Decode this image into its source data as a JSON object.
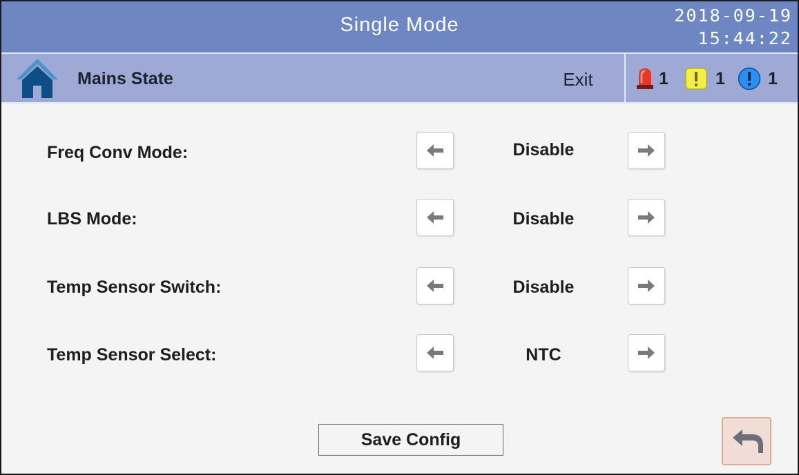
{
  "header": {
    "title": "Single Mode",
    "date": "2018-09-19",
    "time": "15:44:22"
  },
  "subbar": {
    "home_icon": "home-icon",
    "page_title": "Mains State",
    "exit_label": "Exit",
    "alarms": [
      {
        "icon": "red-alarm-light-icon",
        "count": "1",
        "color": "#e23a2a"
      },
      {
        "icon": "yellow-warning-icon",
        "count": "1",
        "color": "#f3ef4a"
      },
      {
        "icon": "blue-info-icon",
        "count": "1",
        "color": "#2b8ff0"
      }
    ]
  },
  "settings": [
    {
      "label": "Freq Conv Mode:",
      "value": "Disable"
    },
    {
      "label": "LBS Mode:",
      "value": "Disable"
    },
    {
      "label": "Temp Sensor Switch:",
      "value": "Disable"
    },
    {
      "label": "Temp Sensor Select:",
      "value": "NTC"
    }
  ],
  "footer": {
    "save_label": "Save Config",
    "back_icon": "return-arrow-icon"
  },
  "colors": {
    "title_bar": "#6e86c1",
    "sub_bar": "#9fa9d6",
    "background": "#f4f4f4",
    "back_button": "#f2ddd6"
  }
}
